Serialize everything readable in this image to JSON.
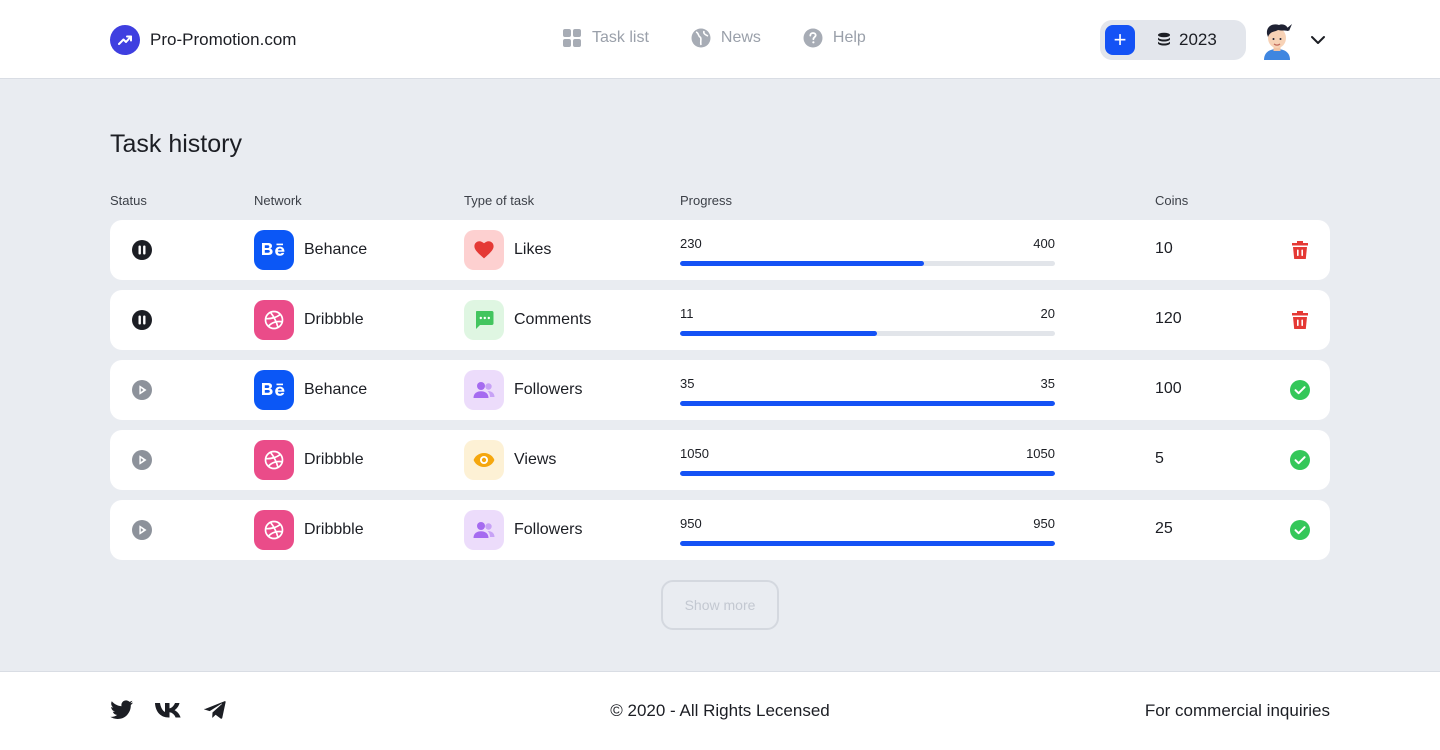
{
  "brand": {
    "name": "Pro-Promotion.com",
    "logo_icon": "trend-up-icon",
    "logo_color": "#3f3fe0"
  },
  "nav": [
    {
      "label": "Task list",
      "icon": "grid-icon"
    },
    {
      "label": "News",
      "icon": "globe-icon"
    },
    {
      "label": "Help",
      "icon": "question-icon"
    }
  ],
  "balance": {
    "value": "2023",
    "add_label": "+",
    "icon": "coin-stack-icon"
  },
  "colors": {
    "accent": "#1452f5",
    "behance": "#0b57f6",
    "dribbble": "#ea4c89",
    "delete": "#e53935",
    "done": "#34c759"
  },
  "page": {
    "title": "Task history"
  },
  "columns": {
    "status": "Status",
    "network": "Network",
    "type": "Type of task",
    "progress": "Progress",
    "coins": "Coins"
  },
  "rows": [
    {
      "status": "paused",
      "network": "Behance",
      "network_icon": "behance-icon",
      "task": "Likes",
      "task_icon": "heart-icon",
      "done": "230",
      "total": "400",
      "progress": 0.65,
      "coins": "10",
      "action": "delete"
    },
    {
      "status": "paused",
      "network": "Dribbble",
      "network_icon": "dribbble-icon",
      "task": "Comments",
      "task_icon": "comment-icon",
      "done": "11",
      "total": "20",
      "progress": 0.525,
      "coins": "120",
      "action": "delete"
    },
    {
      "status": "play",
      "network": "Behance",
      "network_icon": "behance-icon",
      "task": "Followers",
      "task_icon": "users-icon",
      "done": "35",
      "total": "35",
      "progress": 1,
      "coins": "100",
      "action": "done"
    },
    {
      "status": "play",
      "network": "Dribbble",
      "network_icon": "dribbble-icon",
      "task": "Views",
      "task_icon": "eye-icon",
      "done": "1050",
      "total": "1050",
      "progress": 1,
      "coins": "5",
      "action": "done"
    },
    {
      "status": "play",
      "network": "Dribbble",
      "network_icon": "dribbble-icon",
      "task": "Followers",
      "task_icon": "users-icon",
      "done": "950",
      "total": "950",
      "progress": 1,
      "coins": "25",
      "action": "done"
    }
  ],
  "show_more": "Show more",
  "footer": {
    "socials": [
      "twitter-icon",
      "vk-icon",
      "telegram-icon"
    ],
    "copyright": "© 2020 - All Rights Lecensed",
    "commercial": "For commercial inquiries"
  }
}
